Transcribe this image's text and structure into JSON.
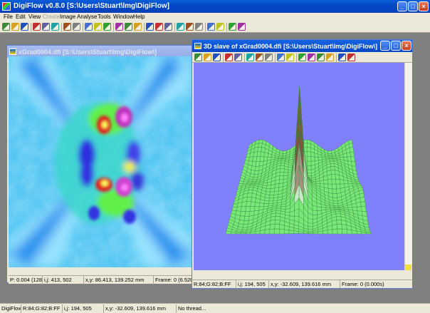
{
  "window": {
    "title": "DigiFlow v0.8.0 [S:\\Users\\Stuart\\lmg\\DigiFlow]",
    "min_glyph": "_",
    "max_glyph": "□",
    "close_glyph": "×"
  },
  "menu": [
    {
      "label": "File",
      "disabled": false
    },
    {
      "label": "Edit",
      "disabled": false
    },
    {
      "label": "View",
      "disabled": false
    },
    {
      "label": "Create",
      "disabled": true
    },
    {
      "label": "Image",
      "disabled": false
    },
    {
      "label": "Analyse",
      "disabled": false
    },
    {
      "label": "Tools",
      "disabled": false
    },
    {
      "label": "Window",
      "disabled": false
    },
    {
      "label": "Help",
      "disabled": false
    }
  ],
  "main_toolbar_icons": [
    "new-icon",
    "open-icon",
    "save-icon",
    "print-icon",
    "copy-icon",
    "paste-icon",
    "cut-icon",
    "undo-icon",
    "zoom-in-icon",
    "zoom-out-icon",
    "fit-icon",
    "select-icon",
    "coordinates-icon",
    "measure-icon",
    "palette-icon",
    "histogram-icon",
    "hand-icon",
    "colour-bar-icon",
    "refresh-icon",
    "export-icon",
    "wrench-icon",
    "cross-icon",
    "arrow-icon",
    "pointer-icon"
  ],
  "image_window": {
    "title": "xGrad0004.dfi  [S:\\Users\\Stuart\\lmg\\DigiFlow\\]",
    "status": {
      "p": "P: 0.004 (128)",
      "ij": "i,j: 413, 502",
      "xy": "x,y: 86.413, 139.252 mm",
      "frame": "Frame: 0 (6.520"
    }
  },
  "plot_window": {
    "title": "3D slave of xGrad0004.dfi  [S:\\Users\\Stuart\\lmg\\DigiFlow\\]",
    "toolbar_icons": [
      "rotate-x-icon",
      "rotate-y-icon",
      "rotate-z-icon",
      "zoom-out-icon",
      "zoom-in-icon",
      "view-a-icon",
      "view-b-icon",
      "view-c-icon",
      "render-icon",
      "mesh-icon",
      "grid-icon",
      "colour-icon",
      "light-icon",
      "palette-icon",
      "pointer-icon",
      "reset-icon"
    ],
    "status": {
      "rgb": "R:84;G:82;B:FF",
      "ij": "i,j: 194, 505",
      "xy": "x,y: -32.609, 139.616 mm",
      "frame": "Frame: 0 (0.000s)"
    }
  },
  "app_status": {
    "name": "DigiFlow",
    "rgb": "R:84;G:82;B:FF",
    "ij": "i,j: 194, 505",
    "xy": "x,y: -32.609, 139.616 mm",
    "thread": "No thread..."
  },
  "colors": {
    "plot_background": "#8080fa",
    "mesh_fill": "#78e878",
    "title_active": "#0446c4",
    "title_inactive": "#94aae6"
  }
}
